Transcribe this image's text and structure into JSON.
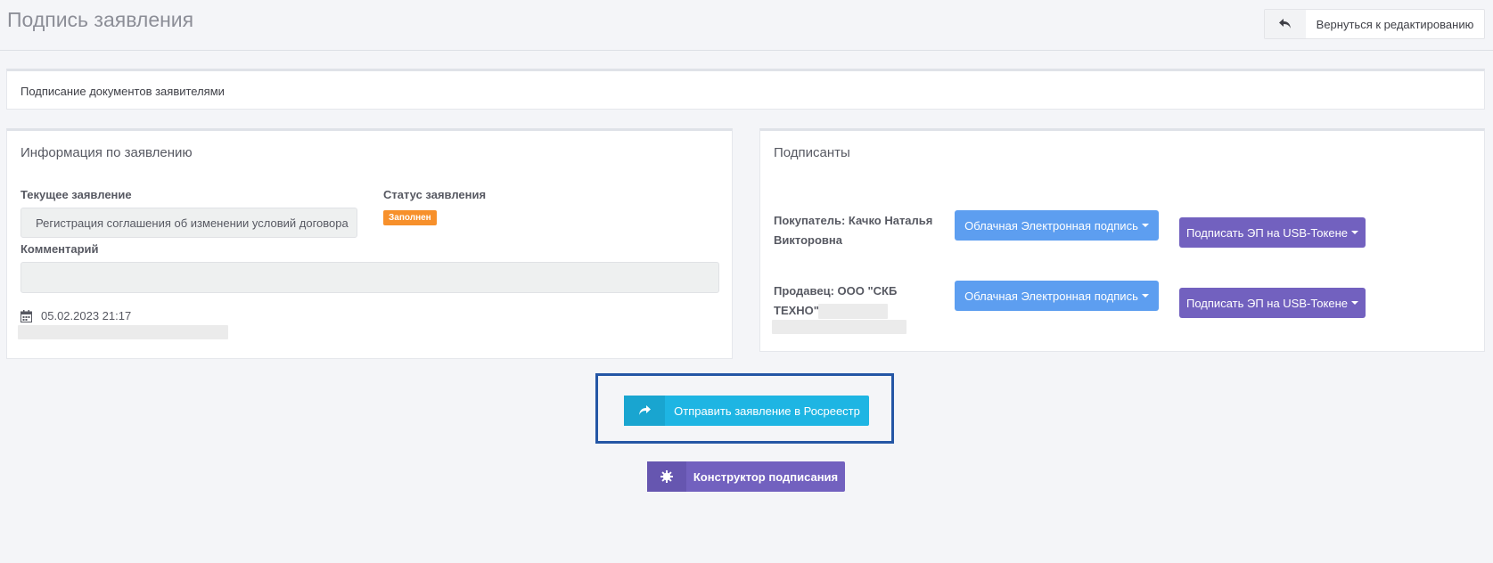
{
  "header": {
    "title": "Подпись заявления",
    "back_button_label": "Вернуться к редактированию"
  },
  "banner": {
    "text": "Подписание документов заявителями"
  },
  "info": {
    "title": "Информация по заявлению",
    "current_label": "Текущее заявление",
    "current_value": "Регистрация соглашения об изменении условий договора",
    "status_label": "Статус заявления",
    "status_badge": "Заполнен",
    "status_badge_color": "#f7902b",
    "comment_label": "Комментарий",
    "comment_value": "",
    "date": "05.02.2023 21:17"
  },
  "signers": {
    "title": "Подписанты",
    "rows": [
      {
        "name": "Покупатель: Качко Наталья Викторовна",
        "cloud_button": "Облачная Электронная подпись",
        "usb_button": "Подписать ЭП на USB-Токене"
      },
      {
        "name": "Продавец: ООО \"СКБ ТЕХНО\"",
        "cloud_button": "Облачная Электронная подпись",
        "usb_button": "Подписать ЭП на USB-Токене"
      }
    ]
  },
  "actions": {
    "send_label": "Отправить заявление в Росреестр",
    "constructor_label": "Конструктор подписания"
  },
  "colors": {
    "cloud": "#5d9ef0",
    "usb": "#7261bf",
    "send": "#1eb5e3",
    "highlight": "#2456a5"
  }
}
